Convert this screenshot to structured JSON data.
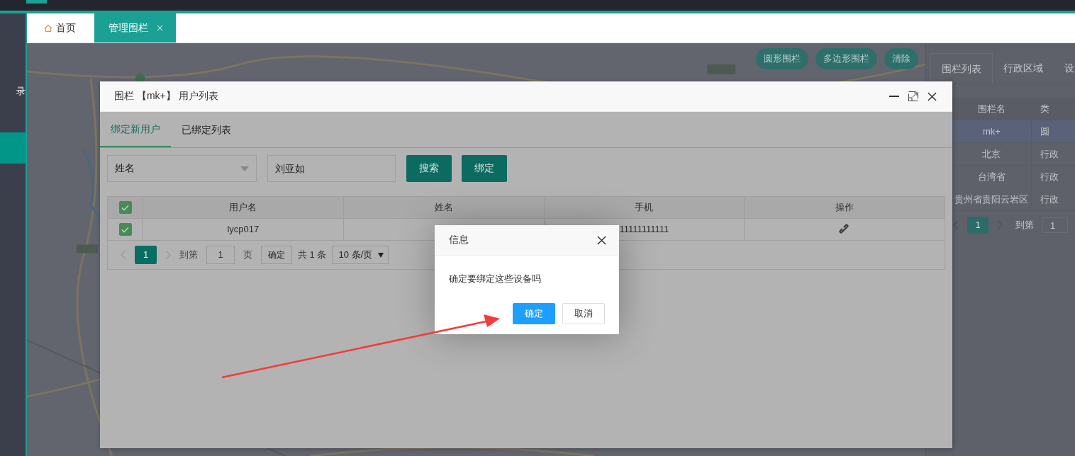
{
  "sidebar": {
    "items": [
      {
        "label": "录",
        "selected": false
      },
      {
        "selected": true
      }
    ]
  },
  "tabs": [
    {
      "label": "首页",
      "selected": false,
      "closable": false
    },
    {
      "label": "管理围栏",
      "selected": true,
      "closable": true
    }
  ],
  "map": {
    "kind": "picture",
    "buttons": [
      "圆形围栏",
      "多边形围栏",
      "清除"
    ]
  },
  "side_panel": {
    "tabs": [
      {
        "label": "围栏列表",
        "selected": true
      },
      {
        "label": "行政区域",
        "selected": false
      },
      {
        "label": "设",
        "selected": false
      }
    ],
    "table": {
      "columns": [
        "围栏名",
        "类"
      ],
      "rows": [
        {
          "cells": [
            "mk+",
            "圆"
          ],
          "selected": true
        },
        {
          "cells": [
            "北京",
            "行政"
          ],
          "selected": false
        },
        {
          "cells": [
            "台湾省",
            "行政"
          ],
          "selected": false
        },
        {
          "cells": [
            "贵州省贵阳云岩区",
            "行政"
          ],
          "selected": false
        }
      ]
    },
    "pager": {
      "pages": [
        {
          "label": "1",
          "selected": true
        }
      ],
      "goto_label": "到第",
      "goto_value": "1"
    }
  },
  "modal": {
    "title": "围栏 【mk+】 用户列表",
    "tabs": [
      {
        "label": "绑定新用户",
        "selected": true
      },
      {
        "label": "已绑定列表",
        "selected": false
      }
    ],
    "filter": {
      "field": "姓名",
      "query": "刘亚如"
    },
    "buttons": [
      "搜索",
      "绑定"
    ],
    "table": {
      "all_checked": true,
      "columns": [
        "用户名",
        "姓名",
        "手机",
        "操作"
      ],
      "rows": [
        {
          "checked": true,
          "username": "lycp017",
          "phone": "11111111111"
        }
      ],
      "pager": {
        "pages": [
          {
            "label": "1",
            "selected": true
          }
        ],
        "goto_label": "到第",
        "goto_value": "1",
        "page_label": "页",
        "confirm": "确定",
        "total": "共 1 条",
        "page_size": "10 条/页"
      }
    }
  },
  "dialog": {
    "title": "信息",
    "message": "确定要绑定这些设备吗",
    "buttons": [
      {
        "label": "确定",
        "kind": "primary"
      },
      {
        "label": "取消",
        "kind": "secondary"
      }
    ]
  }
}
